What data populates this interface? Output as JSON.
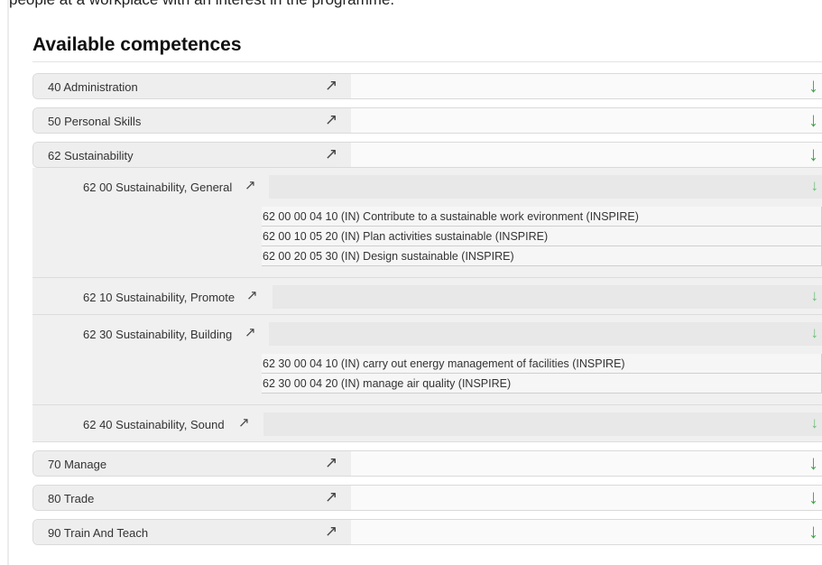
{
  "header_clip": "people at a workplace with an interest in the programme.",
  "title": "Available competences",
  "categories_top": [
    {
      "label": "40 Administration"
    },
    {
      "label": "50 Personal Skills"
    },
    {
      "label": "62 Sustainability"
    }
  ],
  "subgroups": [
    {
      "label": "62 00 Sustainability, General",
      "items": [
        "62 00 00 04 10 (IN) Contribute to a sustainable work evironment (INSPIRE)",
        "62 00 10 05 20 (IN) Plan activities sustainable (INSPIRE)",
        "62 00 20 05 30 (IN) Design sustainable (INSPIRE)"
      ]
    },
    {
      "label": "62 10 Sustainability, Promote",
      "items": []
    },
    {
      "label": "62 30 Sustainability, Building",
      "items": [
        "62 30 00 04 10 (IN) carry out energy management of facilities (INSPIRE)",
        "62 30 00 04 20 (IN) manage air quality (INSPIRE)"
      ]
    },
    {
      "label": "62 40 Sustainability, Sound",
      "items": []
    }
  ],
  "categories_bottom": [
    {
      "label": "70 Manage"
    },
    {
      "label": "80 Trade"
    },
    {
      "label": "90 Train And Teach"
    }
  ],
  "icons": {
    "open": "↗",
    "expand": "↓"
  },
  "colors": {
    "expand_green": "#3fa34d"
  }
}
